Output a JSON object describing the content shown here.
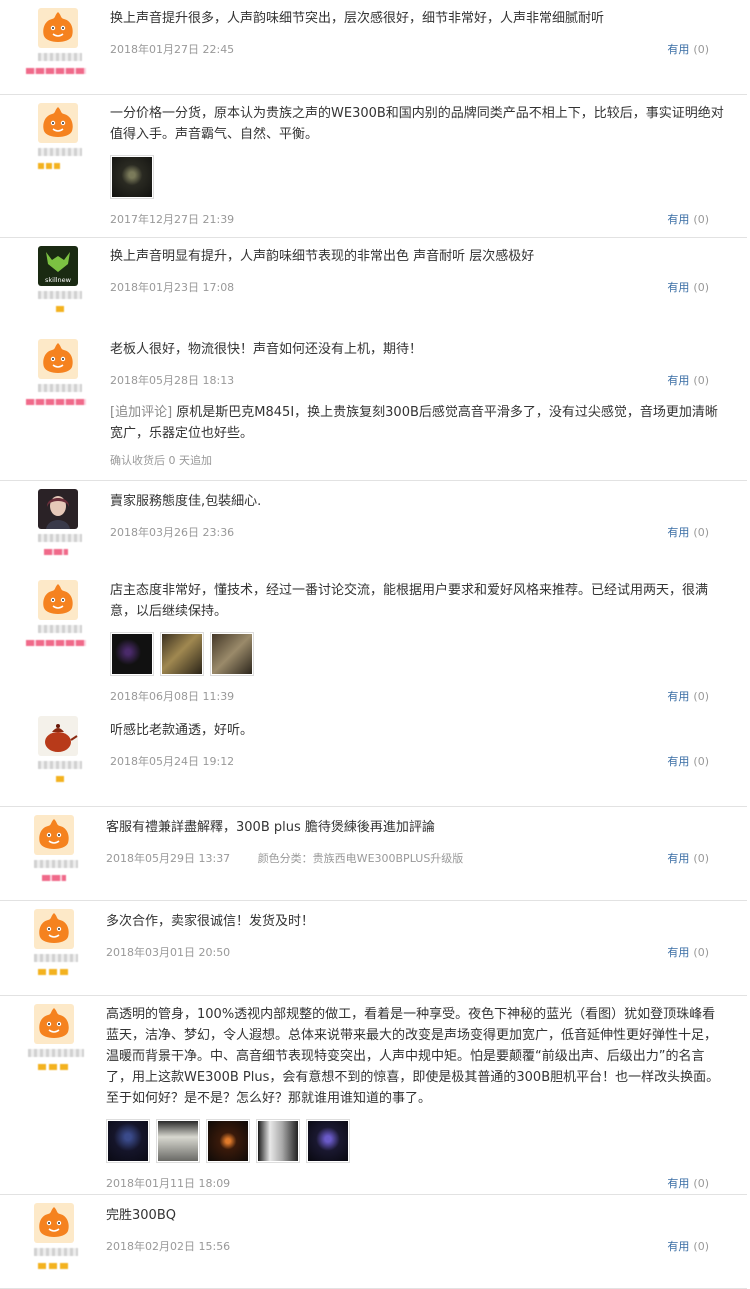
{
  "useful_label": "有用",
  "reviews": [
    {
      "text": "换上声音提升很多，人声韵味细节突出，层次感很好，细节非常好，人声非常细腻耐听",
      "date": "2018年01月27日 22:45",
      "useful": "(0)"
    },
    {
      "text": "一分价格一分货，原本认为贵族之声的WE300B和国内别的品牌同类产品不相上下，比较后，事实证明绝对值得入手。声音霸气、自然、平衡。",
      "date": "2017年12月27日 21:39",
      "useful": "(0)"
    },
    {
      "text": "换上声音明显有提升，人声韵味细节表现的非常出色 声音耐听 层次感极好",
      "date": "2018年01月23日 17:08",
      "useful": "(0)",
      "avatar_text": "skillnew"
    },
    {
      "text": "老板人很好，物流很快！声音如何还没有上机，期待！",
      "date": "2018年05月28日 18:13",
      "useful": "(0)",
      "append_tag": "[追加评论]",
      "append_text": "原机是斯巴克M845I，换上贵族复刻300B后感觉高音平滑多了，没有过尖感觉，音场更加清晰宽广，乐器定位也好些。",
      "append_time": "确认收货后 0 天追加"
    },
    {
      "text": "賣家服務態度佳,包裝細心.",
      "date": "2018年03月26日 23:36",
      "useful": "(0)"
    },
    {
      "text": "店主态度非常好，懂技术，经过一番讨论交流，能根据用户要求和爱好风格来推荐。已经试用两天，很满意，以后继续保持。",
      "date": "2018年06月08日 11:39",
      "useful": "(0)"
    },
    {
      "text": "听感比老款通透，好听。",
      "date": "2018年05月24日 19:12",
      "useful": "(0)"
    },
    {
      "text": "客服有禮兼詳盡解釋，300B plus 膽待煲練後再進加評論",
      "date": "2018年05月29日 13:37",
      "sku": "颜色分类：贵族西电WE300BPLUS升级版",
      "useful": "(0)"
    },
    {
      "text": "多次合作，卖家很诚信！发货及时！",
      "date": "2018年03月01日 20:50",
      "useful": "(0)"
    },
    {
      "text": "高透明的管身，100%透视内部规整的做工，看着是一种享受。夜色下神秘的蓝光（看图）犹如登顶珠峰看蓝天，洁净、梦幻，令人遐想。总体来说带来最大的改变是声场变得更加宽广，低音延伸性更好弹性十足，温暖而背景干净。中、高音细节表现特变突出，人声中规中矩。怕是要颠覆“前级出声、后级出力”的名言了，用上这款WE300B Plus，会有意想不到的惊喜，即使是极其普通的300B胆机平台！也一样改头换面。至于如何好？是不是？怎么好？那就谁用谁知道的事了。",
      "date": "2018年01月11日 18:09",
      "useful": "(0)"
    },
    {
      "text": "完胜300BQ",
      "date": "2018年02月02日 15:56",
      "useful": "(0)"
    }
  ]
}
